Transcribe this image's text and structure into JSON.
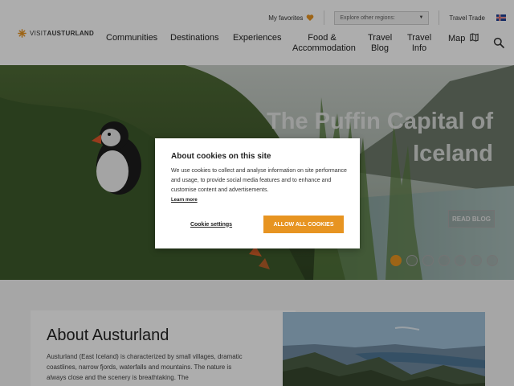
{
  "header": {
    "logo": {
      "visit": "VISIT",
      "name": "AUSTURLAND"
    },
    "utility": {
      "favorites_label": "My favorites",
      "region_placeholder": "Explore other regions:",
      "travel_trade_label": "Travel Trade"
    },
    "nav": [
      {
        "line1": "Communities",
        "line2": ""
      },
      {
        "line1": "Destinations",
        "line2": ""
      },
      {
        "line1": "Experiences",
        "line2": ""
      },
      {
        "line1": "Food &",
        "line2": "Accommodation"
      },
      {
        "line1": "Travel",
        "line2": "Blog"
      },
      {
        "line1": "Travel",
        "line2": "Info"
      },
      {
        "line1": "Map",
        "line2": ""
      }
    ]
  },
  "hero": {
    "title_line1": "The Puffin Capital of",
    "title_line2": "Iceland",
    "cta_label": "READ BLOG",
    "slide_count": 7,
    "active_slide": 1
  },
  "about": {
    "title": "About Austurland",
    "text": "Austurland (East Iceland) is characterized by small villages, dramatic coastlines, narrow fjords, waterfalls and mountains. The nature is always close and the scenery is breathtaking. The"
  },
  "cookie_dialog": {
    "title": "About cookies on this site",
    "body": "We use cookies to collect and analyse information on site performance and usage, to provide social media features and to enhance and customise content and advertisements.",
    "learn_more": "Learn more",
    "settings_label": "Cookie settings",
    "allow_label": "ALLOW ALL COOKIES"
  },
  "colors": {
    "accent": "#e79421",
    "overlay": "rgba(0,0,0,0.32)"
  },
  "icons": [
    "logo-star-icon",
    "heart-icon",
    "chevron-down-icon",
    "flag-icon",
    "map-icon",
    "search-icon"
  ]
}
